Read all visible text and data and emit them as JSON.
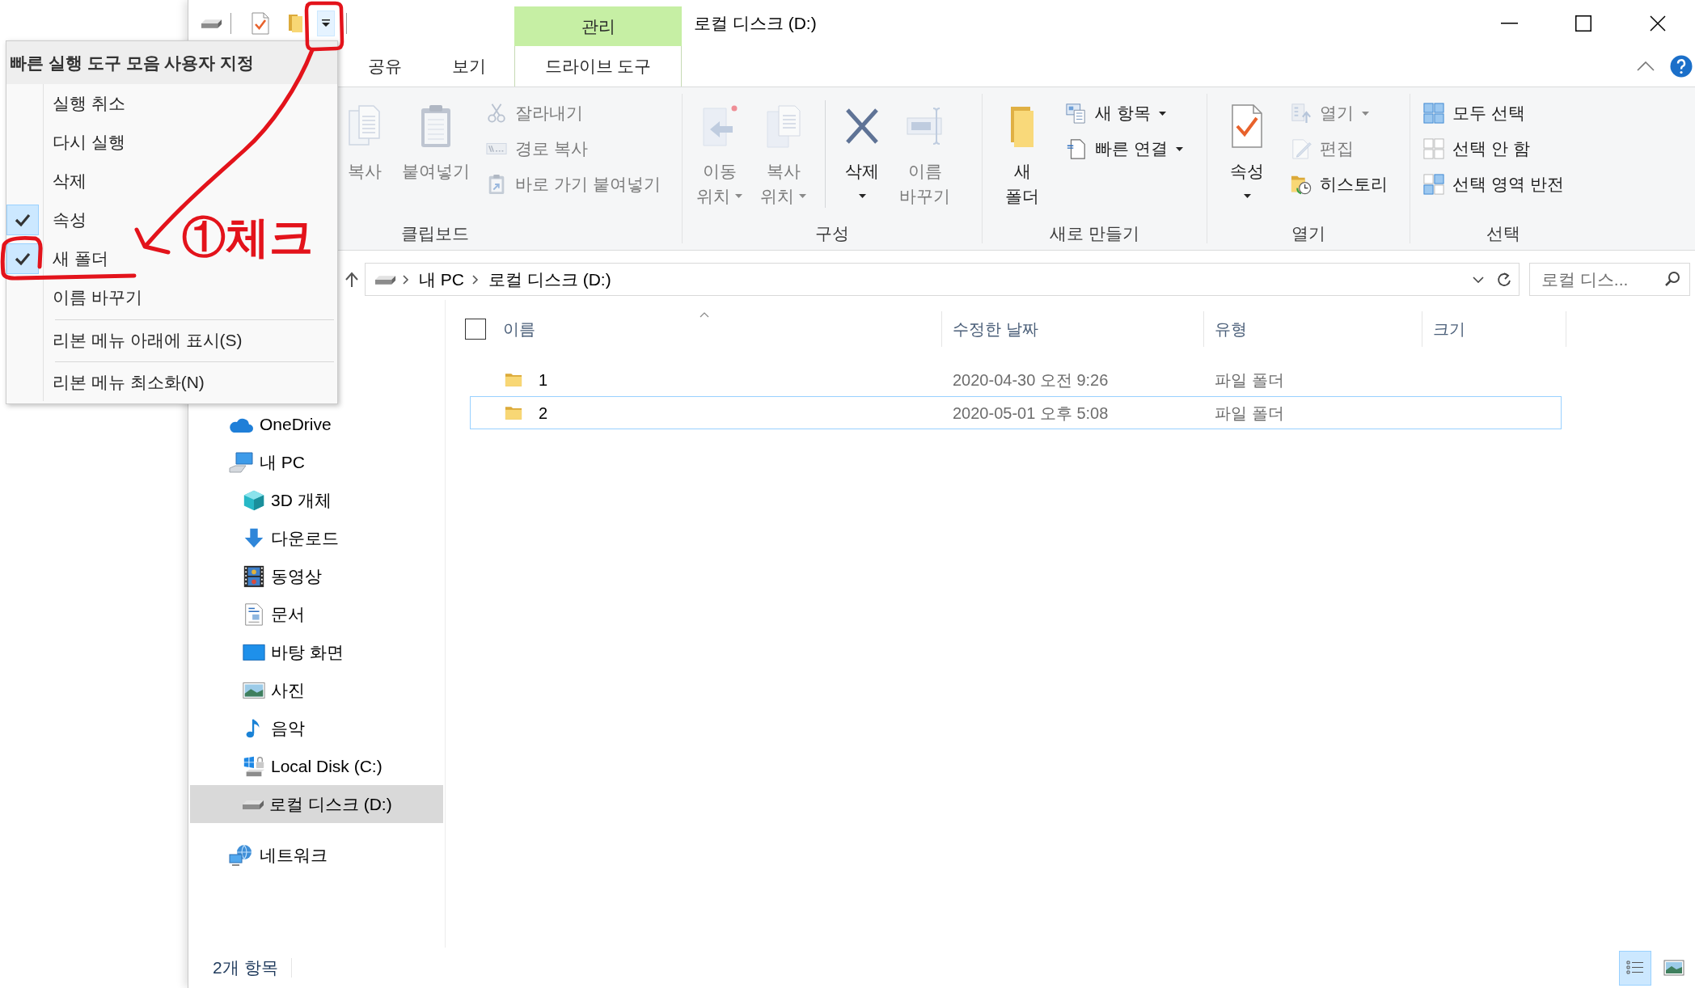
{
  "window": {
    "title": "로컬 디스크 (D:)"
  },
  "quick_access_menu": {
    "expanded": true,
    "title": "빠른 실행 도구 모음 사용자 지정",
    "items": [
      {
        "kind": "check",
        "label": "실행 취소",
        "checked": false
      },
      {
        "kind": "check",
        "label": "다시 실행",
        "checked": false
      },
      {
        "kind": "check",
        "label": "삭제",
        "checked": false
      },
      {
        "kind": "check",
        "label": "속성",
        "checked": true
      },
      {
        "kind": "check",
        "label": "새 폴더",
        "checked": true
      },
      {
        "kind": "check",
        "label": "이름 바꾸기",
        "checked": false
      },
      {
        "kind": "command",
        "label": "리본 메뉴 아래에 표시(S)"
      },
      {
        "kind": "command",
        "label": "리본 메뉴 최소화(N)"
      }
    ]
  },
  "ribbon": {
    "context_group": {
      "label": "관리",
      "tabs": [
        {
          "label": "드라이브 도구",
          "selected": true
        }
      ]
    },
    "tabs": [
      {
        "label": "공유",
        "selected": false
      },
      {
        "label": "보기",
        "selected": false
      }
    ],
    "groups": [
      {
        "label": "클립보드",
        "sections": [
          [
            {
              "kind": "large",
              "lines": [
                "복사"
              ],
              "disabled": true
            },
            {
              "kind": "large",
              "lines": [
                "붙여넣기"
              ],
              "disabled": true
            },
            {
              "kind": "small",
              "lines": [
                "잘라내기"
              ],
              "disabled": true
            },
            {
              "kind": "small",
              "lines": [
                "경로 복사"
              ],
              "disabled": true
            },
            {
              "kind": "small",
              "lines": [
                "바로 가기 붙여넣기"
              ],
              "disabled": true
            }
          ]
        ]
      },
      {
        "label": "구성",
        "sections": [
          [
            {
              "kind": "large",
              "lines": [
                "이동",
                "위치"
              ],
              "dropdown": true,
              "disabled": true
            },
            {
              "kind": "large",
              "lines": [
                "복사",
                "위치"
              ],
              "dropdown": true,
              "disabled": true
            }
          ],
          [
            {
              "kind": "large",
              "lines": [
                "삭제"
              ],
              "dropdown": true,
              "disabled": false
            },
            {
              "kind": "large",
              "lines": [
                "이름",
                "바꾸기"
              ],
              "disabled": true
            }
          ]
        ]
      },
      {
        "label": "새로 만들기",
        "sections": [
          [
            {
              "kind": "large",
              "lines": [
                "새",
                "폴더"
              ],
              "disabled": false
            },
            {
              "kind": "small",
              "lines": [
                "새 항목"
              ],
              "dropdown": true,
              "disabled": false
            },
            {
              "kind": "small",
              "lines": [
                "빠른 연결"
              ],
              "dropdown": true,
              "disabled": false
            }
          ]
        ]
      },
      {
        "label": "열기",
        "sections": [
          [
            {
              "kind": "large",
              "lines": [
                "속성"
              ],
              "dropdown": true,
              "disabled": false
            },
            {
              "kind": "small",
              "lines": [
                "열기"
              ],
              "dropdown": true,
              "disabled": true
            },
            {
              "kind": "small",
              "lines": [
                "편집"
              ],
              "disabled": true
            },
            {
              "kind": "small",
              "lines": [
                "히스토리"
              ],
              "disabled": false
            }
          ]
        ]
      },
      {
        "label": "선택",
        "sections": [
          [
            {
              "kind": "small",
              "lines": [
                "모두 선택"
              ],
              "disabled": false
            },
            {
              "kind": "small",
              "lines": [
                "선택 안 함"
              ],
              "disabled": false
            },
            {
              "kind": "small",
              "lines": [
                "선택 영역 반전"
              ],
              "disabled": false
            }
          ]
        ]
      }
    ]
  },
  "address_bar": {
    "crumbs": [
      "내 PC",
      "로컬 디스크 (D:)"
    ]
  },
  "search": {
    "placeholder": "로컬 디스..."
  },
  "nav_pane": {
    "items": [
      {
        "label": "OneDrive",
        "selected": false
      },
      {
        "label": "내 PC",
        "selected": false,
        "children": [
          {
            "label": "3D 개체",
            "selected": false
          },
          {
            "label": "다운로드",
            "selected": false
          },
          {
            "label": "동영상",
            "selected": false
          },
          {
            "label": "문서",
            "selected": false
          },
          {
            "label": "바탕 화면",
            "selected": false
          },
          {
            "label": "사진",
            "selected": false
          },
          {
            "label": "음악",
            "selected": false
          },
          {
            "label": "Local Disk (C:)",
            "selected": false
          },
          {
            "label": "로컬 디스크 (D:)",
            "selected": true
          }
        ]
      },
      {
        "label": "네트워크",
        "selected": false
      }
    ]
  },
  "file_list": {
    "select_all": {
      "checked": false
    },
    "columns": [
      {
        "label": "이름",
        "sorted": true
      },
      {
        "label": "수정한 날짜"
      },
      {
        "label": "유형"
      },
      {
        "label": "크기"
      }
    ],
    "rows": [
      {
        "name": "1",
        "modified": "2020-04-30 오전 9:26",
        "type": "파일 폴더",
        "selected": false,
        "focused": false
      },
      {
        "name": "2",
        "modified": "2020-05-01 오후 5:08",
        "type": "파일 폴더",
        "selected": false,
        "focused": true
      }
    ]
  },
  "status_bar": {
    "item_count": "2개 항목",
    "views": [
      {
        "selected": true
      },
      {
        "selected": false
      }
    ]
  },
  "annotation": {
    "label": "①체크"
  }
}
